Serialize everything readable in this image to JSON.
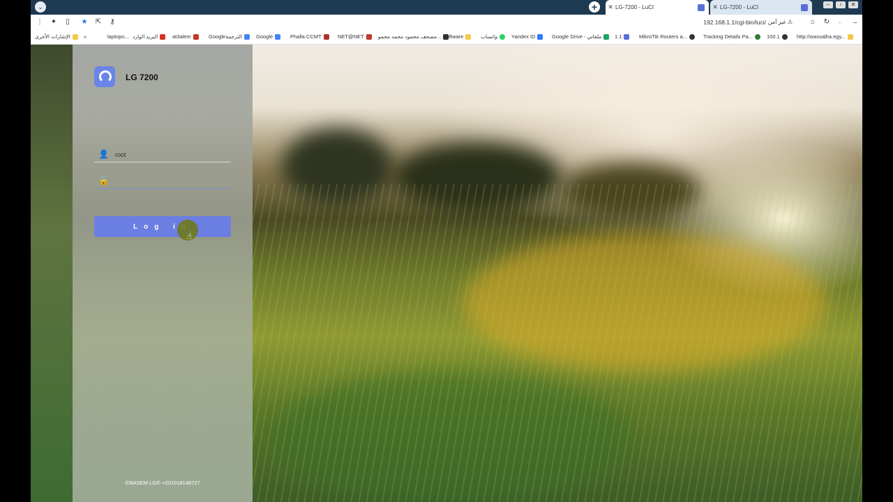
{
  "tabs": [
    {
      "title": "LG-7200 - LuCI",
      "active": true
    },
    {
      "title": "LG-7200 - LuCI",
      "active": false
    }
  ],
  "address": {
    "url": "192.168.1.1/cgi-bin/luci/",
    "security": "غير آمن"
  },
  "bookmarks": [
    {
      "label": "الإشارات الأخرى",
      "color": "#f2c94c"
    },
    {
      "label": "laptopn...",
      "color": "#d93025"
    },
    {
      "label": "البريد الوارد",
      "color": "#d93025"
    },
    {
      "label": "at3alem",
      "color": "#c0392b"
    },
    {
      "label": "Googleالترجمة",
      "color": "#4285f4"
    },
    {
      "label": "Google",
      "color": "#4285f4"
    },
    {
      "label": "Phalla.CCMT",
      "color": "#b03030"
    },
    {
      "label": "NET@NET",
      "color": "#c0392b"
    },
    {
      "label": "مصحف محمود محمد محمو...",
      "color": "#333333"
    },
    {
      "label": "software",
      "color": "#f2c94c"
    },
    {
      "label": "واتساب",
      "color": "#25d366"
    },
    {
      "label": "Yandex ID",
      "color": "#2979ff"
    },
    {
      "label": "Google Drive - ملفاتي",
      "color": "#1fa463"
    },
    {
      "label": "1.1",
      "color": "#5a6fd6"
    },
    {
      "label": "MikroTik Routers a...",
      "color": "#333333"
    },
    {
      "label": "Tracking Details Pa...",
      "color": "#2e7d32"
    },
    {
      "label": "100.1",
      "color": "#333333"
    },
    {
      "label": "http://wassalha.egy...",
      "color": "#f2c94c"
    }
  ],
  "login": {
    "brand": "LG 7200",
    "username_value": "root",
    "password_value": "",
    "button_label": "Log in",
    "footer": "✆BASEM LG✆ +201018148727"
  },
  "colors": {
    "accent": "#6b7fe3",
    "tabstrip": "#1e3a52"
  }
}
